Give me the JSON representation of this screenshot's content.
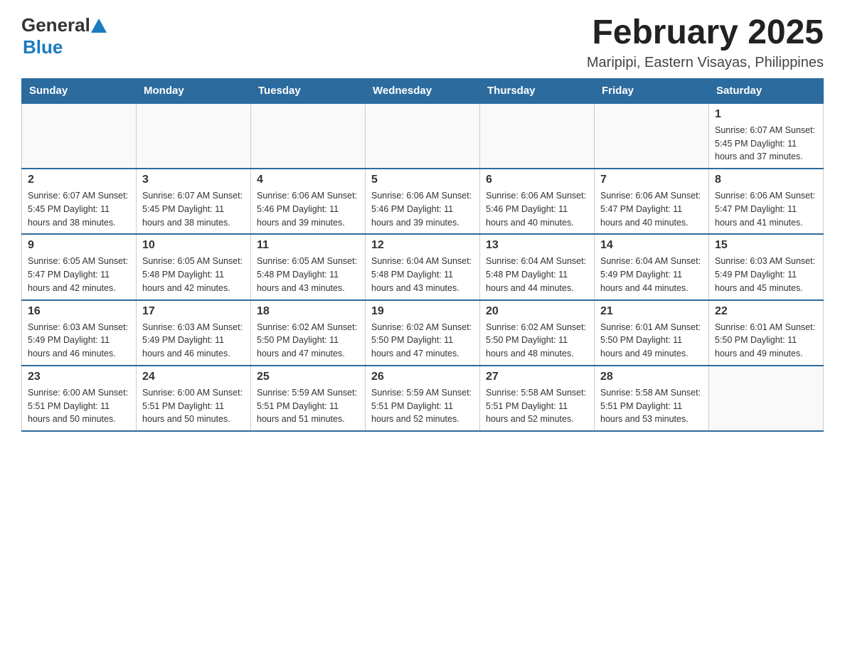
{
  "header": {
    "logo": {
      "general": "General",
      "blue": "Blue"
    },
    "title": "February 2025",
    "subtitle": "Maripipi, Eastern Visayas, Philippines"
  },
  "calendar": {
    "days_of_week": [
      "Sunday",
      "Monday",
      "Tuesday",
      "Wednesday",
      "Thursday",
      "Friday",
      "Saturday"
    ],
    "weeks": [
      {
        "days": [
          {
            "number": "",
            "info": ""
          },
          {
            "number": "",
            "info": ""
          },
          {
            "number": "",
            "info": ""
          },
          {
            "number": "",
            "info": ""
          },
          {
            "number": "",
            "info": ""
          },
          {
            "number": "",
            "info": ""
          },
          {
            "number": "1",
            "info": "Sunrise: 6:07 AM\nSunset: 5:45 PM\nDaylight: 11 hours and 37 minutes."
          }
        ]
      },
      {
        "days": [
          {
            "number": "2",
            "info": "Sunrise: 6:07 AM\nSunset: 5:45 PM\nDaylight: 11 hours and 38 minutes."
          },
          {
            "number": "3",
            "info": "Sunrise: 6:07 AM\nSunset: 5:45 PM\nDaylight: 11 hours and 38 minutes."
          },
          {
            "number": "4",
            "info": "Sunrise: 6:06 AM\nSunset: 5:46 PM\nDaylight: 11 hours and 39 minutes."
          },
          {
            "number": "5",
            "info": "Sunrise: 6:06 AM\nSunset: 5:46 PM\nDaylight: 11 hours and 39 minutes."
          },
          {
            "number": "6",
            "info": "Sunrise: 6:06 AM\nSunset: 5:46 PM\nDaylight: 11 hours and 40 minutes."
          },
          {
            "number": "7",
            "info": "Sunrise: 6:06 AM\nSunset: 5:47 PM\nDaylight: 11 hours and 40 minutes."
          },
          {
            "number": "8",
            "info": "Sunrise: 6:06 AM\nSunset: 5:47 PM\nDaylight: 11 hours and 41 minutes."
          }
        ]
      },
      {
        "days": [
          {
            "number": "9",
            "info": "Sunrise: 6:05 AM\nSunset: 5:47 PM\nDaylight: 11 hours and 42 minutes."
          },
          {
            "number": "10",
            "info": "Sunrise: 6:05 AM\nSunset: 5:48 PM\nDaylight: 11 hours and 42 minutes."
          },
          {
            "number": "11",
            "info": "Sunrise: 6:05 AM\nSunset: 5:48 PM\nDaylight: 11 hours and 43 minutes."
          },
          {
            "number": "12",
            "info": "Sunrise: 6:04 AM\nSunset: 5:48 PM\nDaylight: 11 hours and 43 minutes."
          },
          {
            "number": "13",
            "info": "Sunrise: 6:04 AM\nSunset: 5:48 PM\nDaylight: 11 hours and 44 minutes."
          },
          {
            "number": "14",
            "info": "Sunrise: 6:04 AM\nSunset: 5:49 PM\nDaylight: 11 hours and 44 minutes."
          },
          {
            "number": "15",
            "info": "Sunrise: 6:03 AM\nSunset: 5:49 PM\nDaylight: 11 hours and 45 minutes."
          }
        ]
      },
      {
        "days": [
          {
            "number": "16",
            "info": "Sunrise: 6:03 AM\nSunset: 5:49 PM\nDaylight: 11 hours and 46 minutes."
          },
          {
            "number": "17",
            "info": "Sunrise: 6:03 AM\nSunset: 5:49 PM\nDaylight: 11 hours and 46 minutes."
          },
          {
            "number": "18",
            "info": "Sunrise: 6:02 AM\nSunset: 5:50 PM\nDaylight: 11 hours and 47 minutes."
          },
          {
            "number": "19",
            "info": "Sunrise: 6:02 AM\nSunset: 5:50 PM\nDaylight: 11 hours and 47 minutes."
          },
          {
            "number": "20",
            "info": "Sunrise: 6:02 AM\nSunset: 5:50 PM\nDaylight: 11 hours and 48 minutes."
          },
          {
            "number": "21",
            "info": "Sunrise: 6:01 AM\nSunset: 5:50 PM\nDaylight: 11 hours and 49 minutes."
          },
          {
            "number": "22",
            "info": "Sunrise: 6:01 AM\nSunset: 5:50 PM\nDaylight: 11 hours and 49 minutes."
          }
        ]
      },
      {
        "days": [
          {
            "number": "23",
            "info": "Sunrise: 6:00 AM\nSunset: 5:51 PM\nDaylight: 11 hours and 50 minutes."
          },
          {
            "number": "24",
            "info": "Sunrise: 6:00 AM\nSunset: 5:51 PM\nDaylight: 11 hours and 50 minutes."
          },
          {
            "number": "25",
            "info": "Sunrise: 5:59 AM\nSunset: 5:51 PM\nDaylight: 11 hours and 51 minutes."
          },
          {
            "number": "26",
            "info": "Sunrise: 5:59 AM\nSunset: 5:51 PM\nDaylight: 11 hours and 52 minutes."
          },
          {
            "number": "27",
            "info": "Sunrise: 5:58 AM\nSunset: 5:51 PM\nDaylight: 11 hours and 52 minutes."
          },
          {
            "number": "28",
            "info": "Sunrise: 5:58 AM\nSunset: 5:51 PM\nDaylight: 11 hours and 53 minutes."
          },
          {
            "number": "",
            "info": ""
          }
        ]
      }
    ]
  }
}
